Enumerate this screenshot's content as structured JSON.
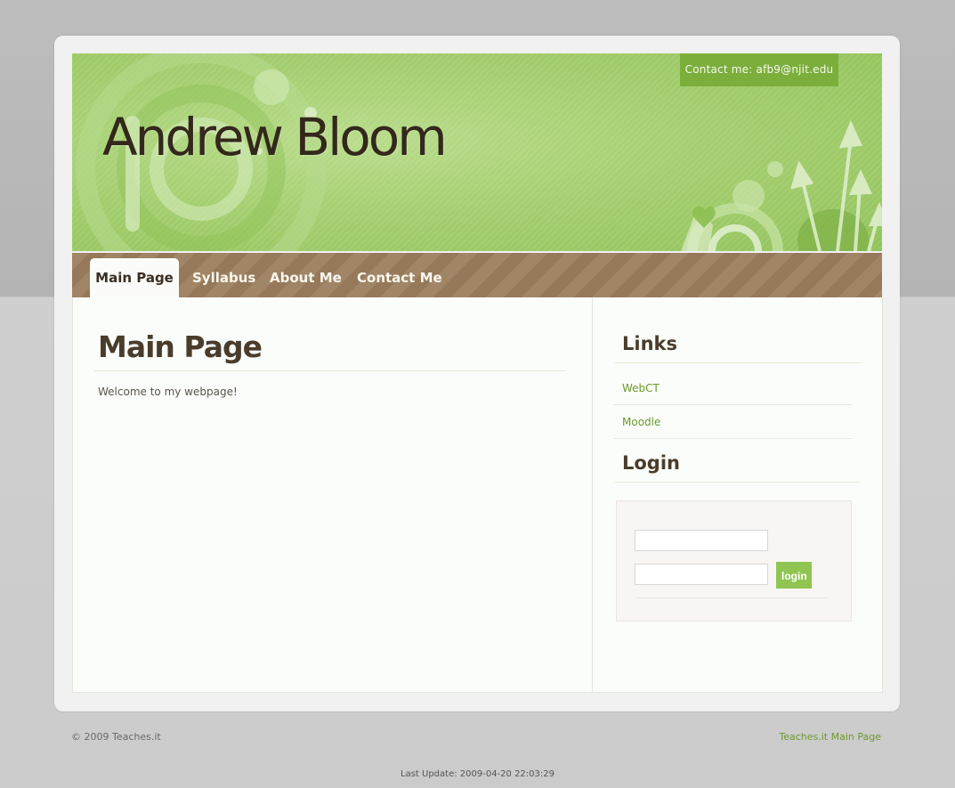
{
  "header": {
    "site_title": "Andrew Bloom",
    "contact_badge": "Contact me: afb9@njit.edu"
  },
  "nav": {
    "items": [
      {
        "label": "Main Page",
        "active": true
      },
      {
        "label": "Syllabus",
        "active": false
      },
      {
        "label": "About Me",
        "active": false
      },
      {
        "label": "Contact Me",
        "active": false
      }
    ]
  },
  "main": {
    "heading": "Main Page",
    "body_text": "Welcome to my webpage!"
  },
  "sidebar": {
    "links_heading": "Links",
    "links": [
      {
        "label": "WebCT"
      },
      {
        "label": "Moodle"
      }
    ],
    "login_heading": "Login",
    "login": {
      "username_value": "",
      "password_value": "",
      "button_label": "login"
    }
  },
  "footer": {
    "copyright": "© 2009 Teaches.it",
    "main_page_link": "Teaches.it Main Page",
    "last_update": "Last Update: 2009-04-20 22:03:29"
  },
  "colors": {
    "header_green": "#a5cf70",
    "badge_green": "#7cae3c",
    "nav_brown": "#a08666",
    "link_green": "#6b9a2c",
    "heading_brown": "#4a3c2c"
  }
}
